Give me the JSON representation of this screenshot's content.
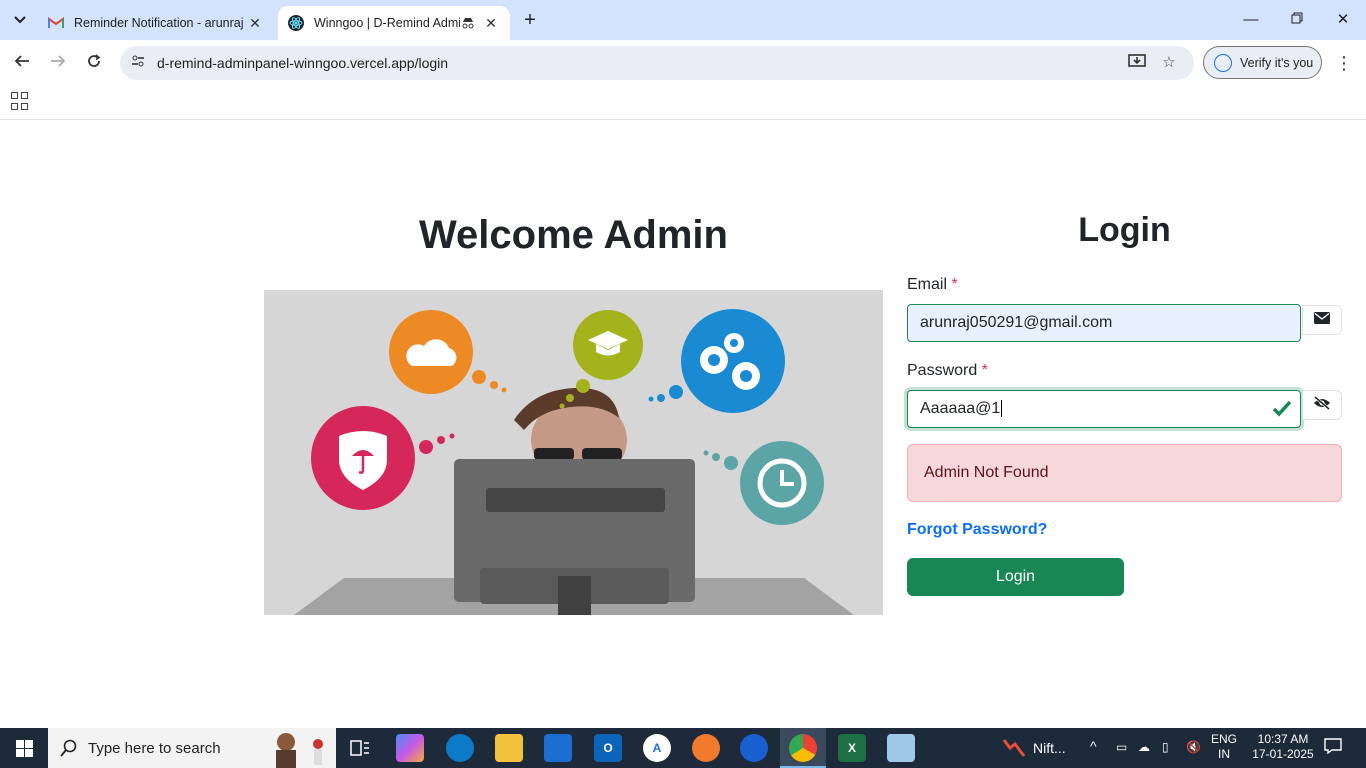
{
  "browser": {
    "tabs": [
      {
        "title": "Reminder Notification - arunraj",
        "favicon": "gmail-icon"
      },
      {
        "title": "Winngoo | D-Remind Admin",
        "favicon": "react-icon"
      }
    ],
    "url": "d-remind-adminpanel-winngoo.vercel.app/login",
    "verify_label": "Verify it's you"
  },
  "page": {
    "welcome_heading": "Welcome Admin",
    "login_heading": "Login",
    "email_label": "Email",
    "email_value": "arunraj050291@gmail.com",
    "password_label": "Password",
    "password_value": "Aaaaaa@1",
    "required_mark": "*",
    "error_message": "Admin Not Found",
    "forgot_link": "Forgot Password?",
    "login_button": "Login",
    "accent_color": "#198754"
  },
  "taskbar": {
    "search_placeholder": "Type here to search",
    "widget_label": "Nift...",
    "language_top": "ENG",
    "language_bottom": "IN",
    "time": "10:37 AM",
    "date": "17-01-2025"
  }
}
